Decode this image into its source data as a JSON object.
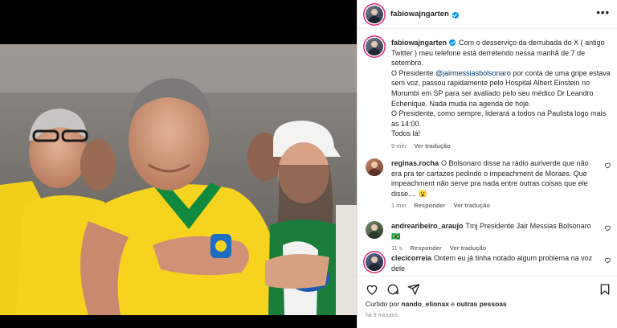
{
  "post": {
    "username": "fabiowajngarten",
    "caption_user": "fabiowajngarten",
    "caption_part1": "Com o desserviço da derrubada do X ( antigo Twitter ) meu telefone está derretendo nessa manhã de 7 de setembro.",
    "caption_part2": "O Presidente ",
    "caption_mention": "@jairmessiasbolsonaro",
    "caption_part3": " por conta de uma gripe estava sem voz, passou rapidamente pelo Hospital Albert Einstein no Morumbi em SP para ser avaliado pelo seu médico Dr Leandro Echenique. Nada muda na agenda de hoje.",
    "caption_part4": "O Presidente, como sempre, liderará a todos na Paulista logo mais as 14:00.",
    "caption_part5": "Todos lá!",
    "caption_time": "9 min",
    "caption_translate": "Ver tradução"
  },
  "comments": [
    {
      "user": "reginas.rocha",
      "text": "O Bolsonaro disse na rádio auriverde que não era pra ter cartazes pedindo o impeachment de Moraes. Que impeachment não serve pra nada entre outras coisas que ele disse.... 😮",
      "time": "1 min",
      "reply": "Responder",
      "translate": "Ver tradução"
    },
    {
      "user": "andrearibeiro_araujo",
      "text": "Tmj Presidente Jair Messias Bolsonaro 🇧🇷",
      "time": "11 s",
      "reply": "Responder",
      "translate": "Ver tradução"
    },
    {
      "user": "clecicorreia",
      "text": "Ontem eu já tinha notado algum problema na voz dele"
    }
  ],
  "likes": {
    "prefix": "Curtido por ",
    "user": "nando_elionax",
    "middle": " e ",
    "others": "outras pessoas"
  },
  "posted_ago": "há 9 minutos",
  "icons": {
    "more": "more-options-icon",
    "like": "heart-icon",
    "comment": "comment-icon",
    "share": "share-icon",
    "save": "bookmark-icon"
  }
}
